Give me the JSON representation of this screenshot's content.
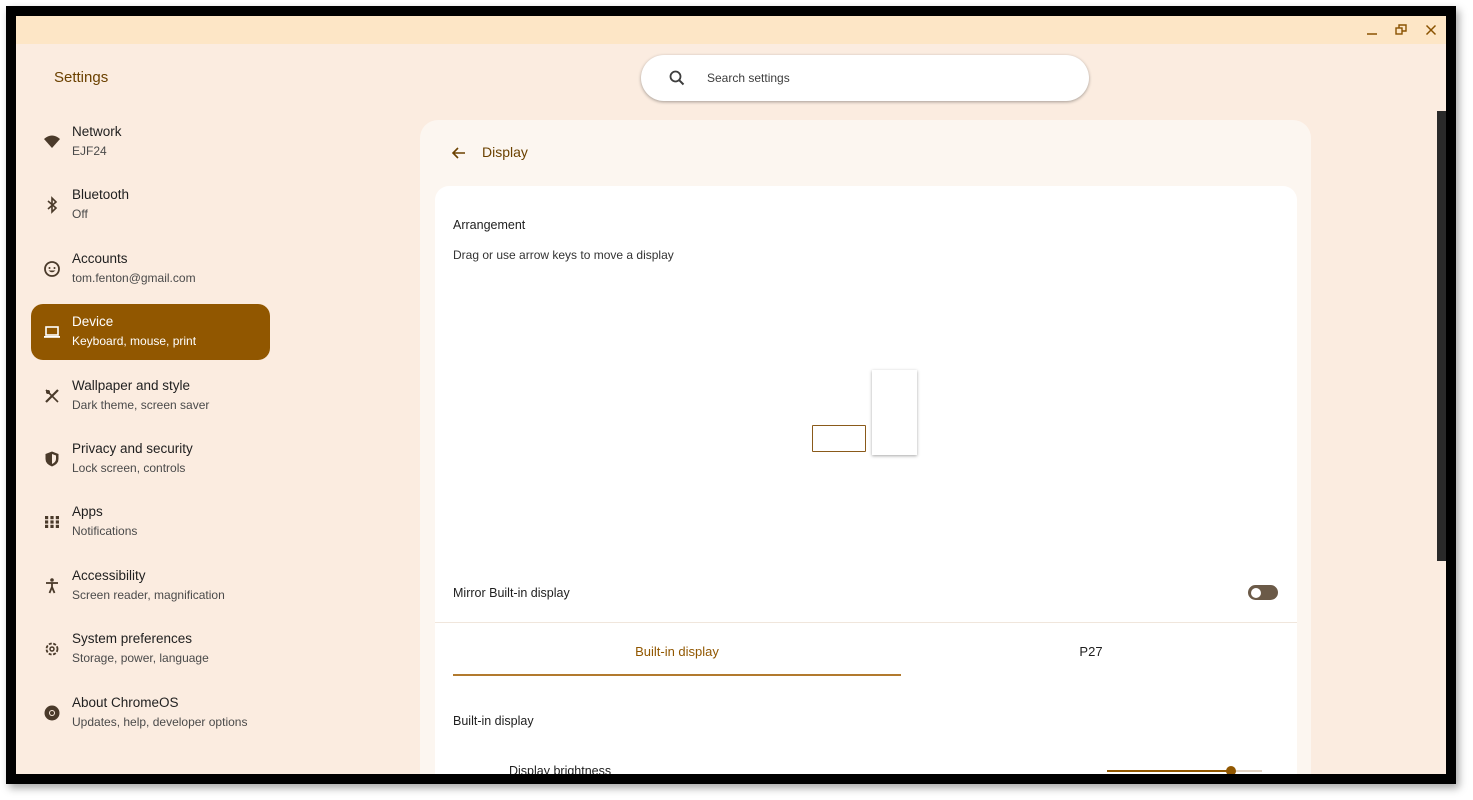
{
  "app": {
    "title": "Settings"
  },
  "window_controls": {
    "minimize_icon": "minimize-icon",
    "restore_icon": "restore-icon",
    "close_icon": "close-icon"
  },
  "search": {
    "placeholder": "Search settings",
    "icon": "search-icon"
  },
  "sidebar": {
    "items": [
      {
        "label": "Network",
        "sub": "EJF24",
        "icon": "wifi-icon"
      },
      {
        "label": "Bluetooth",
        "sub": "Off",
        "icon": "bluetooth-icon"
      },
      {
        "label": "Accounts",
        "sub": "tom.fenton@gmail.com",
        "icon": "account-icon"
      },
      {
        "label": "Device",
        "sub": "Keyboard, mouse, print",
        "icon": "laptop-icon",
        "active": true
      },
      {
        "label": "Wallpaper and style",
        "sub": "Dark theme, screen saver",
        "icon": "palette-icon"
      },
      {
        "label": "Privacy and security",
        "sub": "Lock screen, controls",
        "icon": "shield-icon"
      },
      {
        "label": "Apps",
        "sub": "Notifications",
        "icon": "apps-grid-icon"
      },
      {
        "label": "Accessibility",
        "sub": "Screen reader, magnification",
        "icon": "accessibility-icon"
      },
      {
        "label": "System preferences",
        "sub": "Storage, power, language",
        "icon": "gear-icon"
      },
      {
        "label": "About ChromeOS",
        "sub": "Updates, help, developer options",
        "icon": "chromeos-icon"
      }
    ]
  },
  "main": {
    "page_title": "Display",
    "arrangement": {
      "title": "Arrangement",
      "description": "Drag or use arrow keys to move a display"
    },
    "mirror": {
      "label": "Mirror Built-in display",
      "enabled": false
    },
    "tabs": [
      {
        "label": "Built-in display",
        "selected": true
      },
      {
        "label": "P27",
        "selected": false
      }
    ],
    "built_in": {
      "title": "Built-in display",
      "brightness_label": "Display brightness",
      "brightness_value": 0.8
    }
  },
  "colors": {
    "accent": "#915700",
    "background": "#fbece0",
    "titlebar": "#fde6c6"
  }
}
